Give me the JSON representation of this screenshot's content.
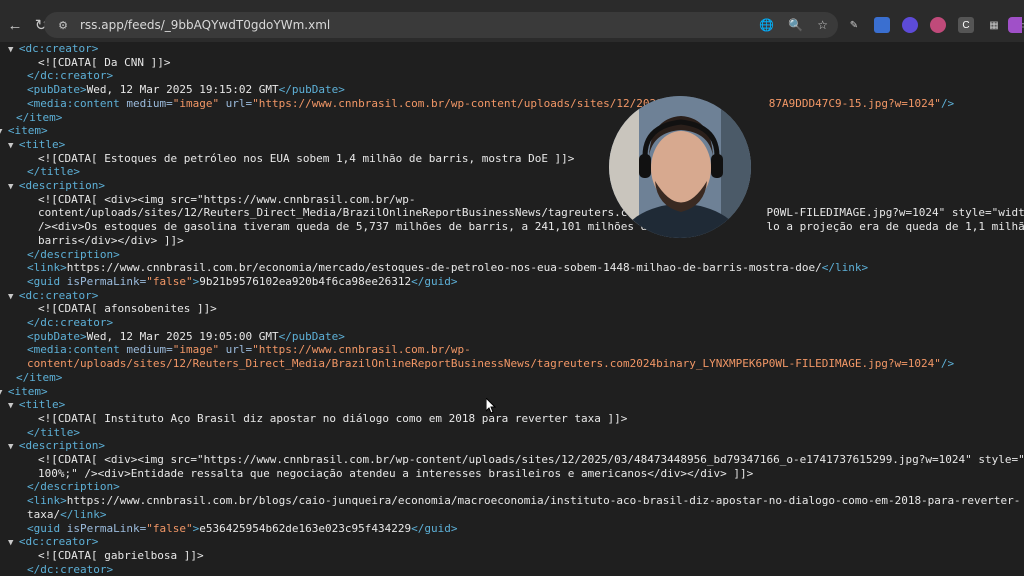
{
  "browser": {
    "url": "rss.app/feeds/_9bbAQYwdT0gdoYWm.xml"
  },
  "xml_lines": [
    {
      "indent": 0,
      "arrow": true,
      "parts": [
        [
          "tag",
          "<dc:creator>"
        ]
      ]
    },
    {
      "indent": 2,
      "arrow": false,
      "parts": [
        [
          "text",
          "<![CDATA[ Da CNN ]]>"
        ]
      ]
    },
    {
      "indent": 1,
      "arrow": false,
      "parts": [
        [
          "tag",
          "</dc:creator>"
        ]
      ]
    },
    {
      "indent": 1,
      "arrow": false,
      "parts": [
        [
          "tag",
          "<pubDate>"
        ],
        [
          "text",
          "Wed, 12 Mar 2025 19:15:02 GMT"
        ],
        [
          "tag",
          "</pubDate>"
        ]
      ]
    },
    {
      "indent": 1,
      "arrow": false,
      "parts": [
        [
          "tag",
          "<media:content "
        ],
        [
          "attr",
          "medium="
        ],
        [
          "val",
          "\"image\""
        ],
        [
          "attr",
          " url="
        ],
        [
          "val",
          "\"https://www.cnnbrasil.com.br/wp-content/uploads/sites/12/2021/06/            87A9DDD47C9-15.jpg?w=1024\""
        ],
        [
          "tag",
          "/>"
        ]
      ]
    },
    {
      "indent": 0,
      "arrow": false,
      "parts": [
        [
          "tag",
          "</item>"
        ]
      ]
    },
    {
      "indent": -1,
      "arrow": true,
      "parts": [
        [
          "tag",
          "<item>"
        ]
      ]
    },
    {
      "indent": 0,
      "arrow": true,
      "parts": [
        [
          "tag",
          "<title>"
        ]
      ]
    },
    {
      "indent": 2,
      "arrow": false,
      "parts": [
        [
          "text",
          "<![CDATA[ Estoques de petróleo nos EUA sobem 1,4 milhão de barris, mostra DoE ]]>"
        ]
      ]
    },
    {
      "indent": 1,
      "arrow": false,
      "parts": [
        [
          "tag",
          "</title>"
        ]
      ]
    },
    {
      "indent": 0,
      "arrow": true,
      "parts": [
        [
          "tag",
          "<description>"
        ]
      ]
    },
    {
      "indent": 2,
      "arrow": false,
      "parts": [
        [
          "text",
          "<![CDATA[ <div><img src=\"https://www.cnnbrasil.com.br/wp-"
        ]
      ]
    },
    {
      "indent": 2,
      "arrow": false,
      "parts": [
        [
          "text",
          "content/uploads/sites/12/Reuters_Direct_Media/BrazilOnlineReportBusinessNews/tagreuters.com202                P0WL-FILEDIMAGE.jpg?w=1024\" style=\"width: 100%;\""
        ]
      ]
    },
    {
      "indent": 2,
      "arrow": false,
      "parts": [
        [
          "text",
          "/><div>Os estoques de gasolina tiveram queda de 5,737 milhões de barris, a 241,101 milhões de ba              lo a projeção era de queda de 1,1 milhão"
        ]
      ]
    },
    {
      "indent": 2,
      "arrow": false,
      "parts": [
        [
          "text",
          "barris</div></div> ]]>"
        ]
      ]
    },
    {
      "indent": 1,
      "arrow": false,
      "parts": [
        [
          "tag",
          "</description>"
        ]
      ]
    },
    {
      "indent": 1,
      "arrow": false,
      "parts": [
        [
          "tag",
          "<link>"
        ],
        [
          "text",
          "https://www.cnnbrasil.com.br/economia/mercado/estoques-de-petroleo-nos-eua-sobem-1448-milhao-de-barris-mostra-doe/"
        ],
        [
          "tag",
          "</link>"
        ]
      ]
    },
    {
      "indent": 1,
      "arrow": false,
      "parts": [
        [
          "tag",
          "<guid "
        ],
        [
          "attr",
          "isPermaLink="
        ],
        [
          "val",
          "\"false\""
        ],
        [
          "tag",
          ">"
        ],
        [
          "text",
          "9b21b9576102ea920b4f6ca98ee26312"
        ],
        [
          "tag",
          "</guid>"
        ]
      ]
    },
    {
      "indent": 0,
      "arrow": true,
      "parts": [
        [
          "tag",
          "<dc:creator>"
        ]
      ]
    },
    {
      "indent": 2,
      "arrow": false,
      "parts": [
        [
          "text",
          "<![CDATA[ afonsobenites ]]>"
        ]
      ]
    },
    {
      "indent": 1,
      "arrow": false,
      "parts": [
        [
          "tag",
          "</dc:creator>"
        ]
      ]
    },
    {
      "indent": 1,
      "arrow": false,
      "parts": [
        [
          "tag",
          "<pubDate>"
        ],
        [
          "text",
          "Wed, 12 Mar 2025 19:05:00 GMT"
        ],
        [
          "tag",
          "</pubDate>"
        ]
      ]
    },
    {
      "indent": 1,
      "arrow": false,
      "parts": [
        [
          "tag",
          "<media:content "
        ],
        [
          "attr",
          "medium="
        ],
        [
          "val",
          "\"image\""
        ],
        [
          "attr",
          " url="
        ],
        [
          "val",
          "\"https://www.cnnbrasil.com.br/wp-"
        ]
      ]
    },
    {
      "indent": 1,
      "arrow": false,
      "parts": [
        [
          "val",
          "content/uploads/sites/12/Reuters_Direct_Media/BrazilOnlineReportBusinessNews/tagreuters.com2024binary_LYNXMPEK6P0WL-FILEDIMAGE.jpg?w=1024\""
        ],
        [
          "tag",
          "/>"
        ]
      ]
    },
    {
      "indent": 0,
      "arrow": false,
      "parts": [
        [
          "tag",
          "</item>"
        ]
      ]
    },
    {
      "indent": -1,
      "arrow": true,
      "parts": [
        [
          "tag",
          "<item>"
        ]
      ]
    },
    {
      "indent": 0,
      "arrow": true,
      "parts": [
        [
          "tag",
          "<title>"
        ]
      ]
    },
    {
      "indent": 2,
      "arrow": false,
      "parts": [
        [
          "text",
          "<![CDATA[ Instituto Aço Brasil diz apostar no diálogo como em 2018 para reverter taxa ]]>"
        ]
      ]
    },
    {
      "indent": 1,
      "arrow": false,
      "parts": [
        [
          "tag",
          "</title>"
        ]
      ]
    },
    {
      "indent": 0,
      "arrow": true,
      "parts": [
        [
          "tag",
          "<description>"
        ]
      ]
    },
    {
      "indent": 2,
      "arrow": false,
      "parts": [
        [
          "text",
          "<![CDATA[ <div><img src=\"https://www.cnnbrasil.com.br/wp-content/uploads/sites/12/2025/03/48473448956_bd79347166_o-e1741737615299.jpg?w=1024\" style=\"width:"
        ]
      ]
    },
    {
      "indent": 2,
      "arrow": false,
      "parts": [
        [
          "text",
          "100%;\" /><div>Entidade ressalta que negociação atendeu a interesses brasileiros e americanos</div></div> ]]>"
        ]
      ]
    },
    {
      "indent": 1,
      "arrow": false,
      "parts": [
        [
          "tag",
          "</description>"
        ]
      ]
    },
    {
      "indent": 1,
      "arrow": false,
      "parts": [
        [
          "tag",
          "<link>"
        ],
        [
          "text",
          "https://www.cnnbrasil.com.br/blogs/caio-junqueira/economia/macroeconomia/instituto-aco-brasil-diz-apostar-no-dialogo-como-em-2018-para-reverter-"
        ]
      ]
    },
    {
      "indent": 1,
      "arrow": false,
      "parts": [
        [
          "text",
          "taxa/"
        ],
        [
          "tag",
          "</link>"
        ]
      ]
    },
    {
      "indent": 1,
      "arrow": false,
      "parts": [
        [
          "tag",
          "<guid "
        ],
        [
          "attr",
          "isPermaLink="
        ],
        [
          "val",
          "\"false\""
        ],
        [
          "tag",
          ">"
        ],
        [
          "text",
          "e536425954b62de163e023c95f434229"
        ],
        [
          "tag",
          "</guid>"
        ]
      ]
    },
    {
      "indent": 0,
      "arrow": true,
      "parts": [
        [
          "tag",
          "<dc:creator>"
        ]
      ]
    },
    {
      "indent": 2,
      "arrow": false,
      "parts": [
        [
          "text",
          "<![CDATA[ gabrielbosa ]]>"
        ]
      ]
    },
    {
      "indent": 1,
      "arrow": false,
      "parts": [
        [
          "tag",
          "</dc:creator>"
        ]
      ]
    }
  ],
  "colors": {
    "tag": "#5db0d7",
    "attr": "#9bbbdc",
    "value": "#f29766",
    "text": "#e8e8e8",
    "background": "#1f1f1f"
  },
  "icons": {
    "back": "arrow-left-icon",
    "reload": "reload-icon",
    "site": "site-info-icon",
    "translate": "translate-icon",
    "zoom": "zoom-icon",
    "bookmark": "star-icon"
  }
}
